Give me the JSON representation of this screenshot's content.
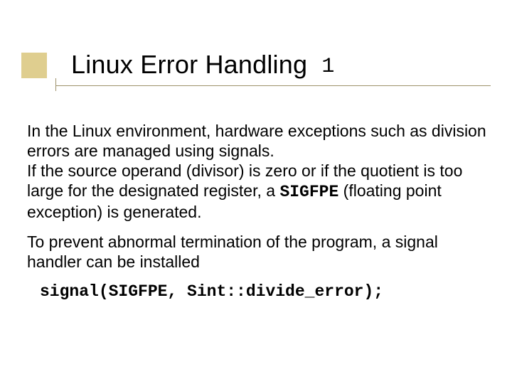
{
  "title": {
    "main": "Linux Error Handling",
    "suffix": "1"
  },
  "body": {
    "p1_a": "In the Linux environment, hardware exceptions such as division errors are managed using signals.",
    "p1_b_pre": "If the source operand (divisor) is zero or if the quotient is too large for the designated register, a ",
    "p1_b_code": "SIGFPE",
    "p1_b_post": " (floating point exception) is generated.",
    "p2": "To prevent abnormal termination of the program, a signal handler can be installed",
    "code": "signal(SIGFPE, Sint::divide_error);"
  }
}
